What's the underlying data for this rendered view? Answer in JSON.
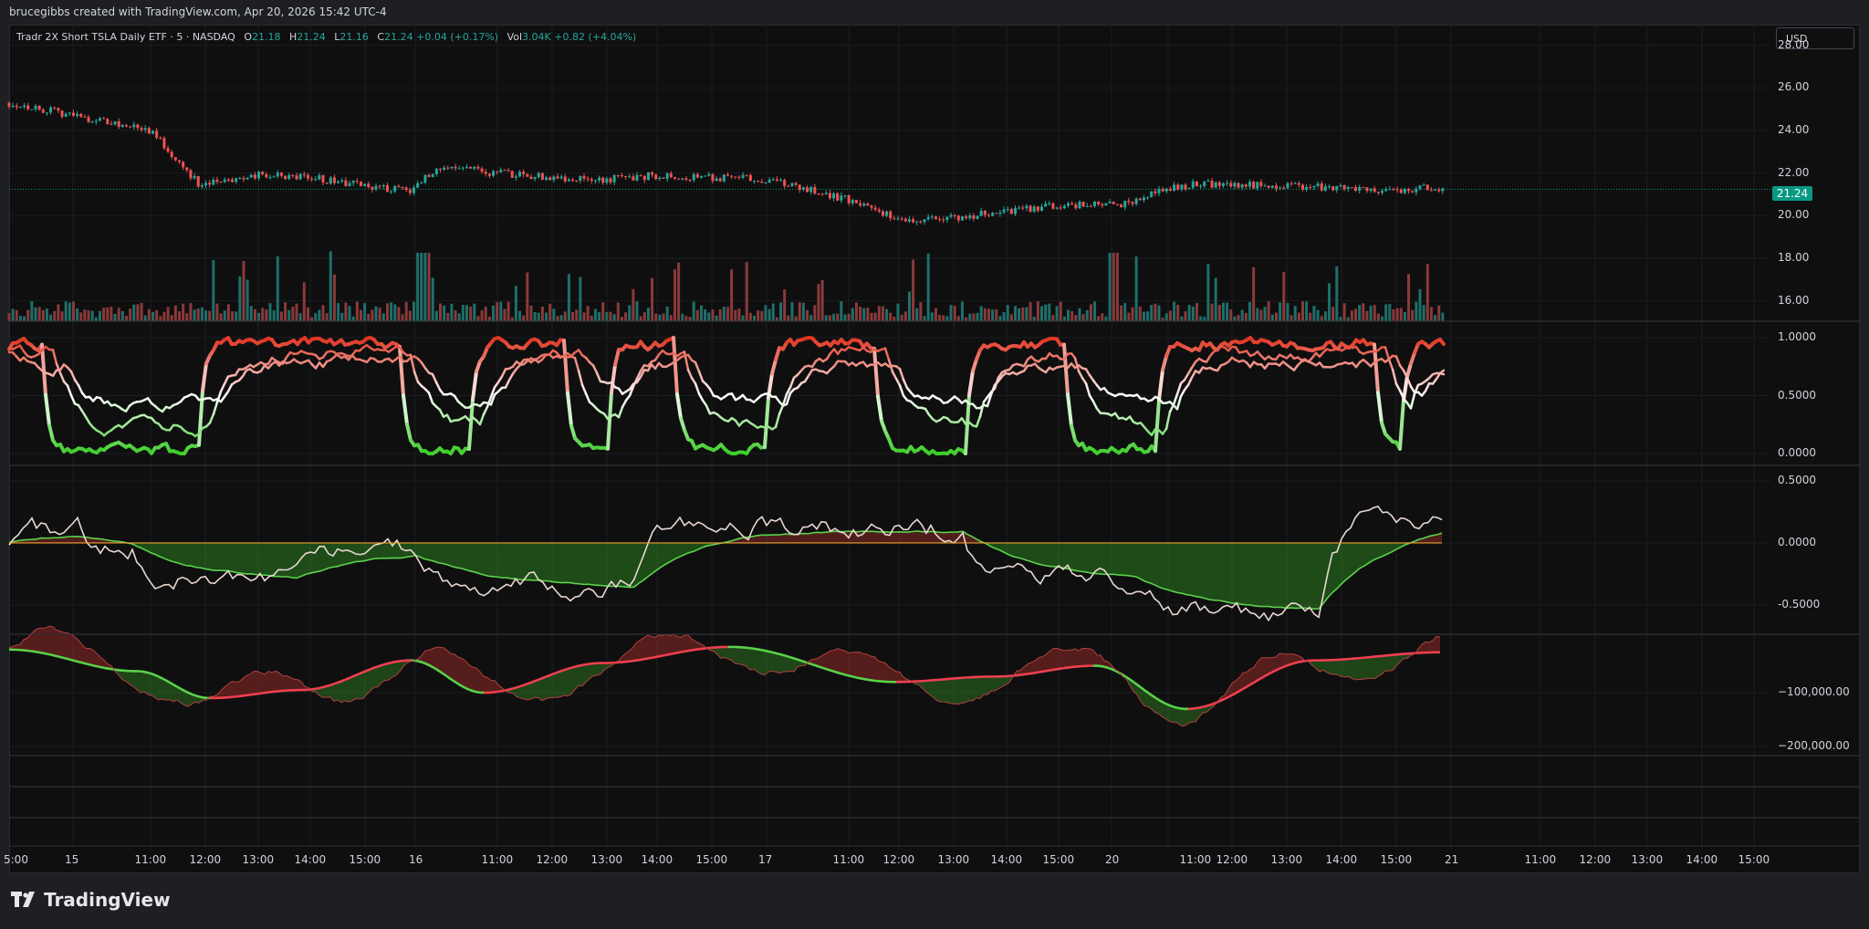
{
  "header": {
    "attribution": "brucegibbs created with TradingView.com, Apr 20, 2026 15:42 UTC-4"
  },
  "legend": {
    "symbol": "Tradr 2X Short TSLA Daily ETF · 5 · NASDAQ",
    "open_label": "O",
    "open": "21.18",
    "high_label": "H",
    "high": "21.24",
    "low_label": "L",
    "low": "21.16",
    "close_label": "C",
    "close": "21.24",
    "change": "+0.04 (+0.17%)",
    "vol_label": "Vol",
    "vol": "3.04K",
    "vol_change": "+0.82 (+4.04%)"
  },
  "currency_button": "USD",
  "price_axis": [
    "28.00",
    "26.00",
    "24.00",
    "22.00",
    "20.00",
    "18.00",
    "16.00"
  ],
  "last_price_tag": "21.24",
  "osc1_axis": [
    "1.0000",
    "0.5000",
    "0.0000"
  ],
  "osc2_axis": [
    "0.5000",
    "0.0000",
    "-0.5000"
  ],
  "osc3_axis": [
    "−100,000.00",
    "−200,000.00"
  ],
  "time_axis": [
    "5:00",
    "15",
    "11:00",
    "12:00",
    "13:00",
    "14:00",
    "15:00",
    "16",
    "11:00",
    "12:00",
    "13:00",
    "14:00",
    "15:00",
    "17",
    "11:00",
    "12:00",
    "13:00",
    "14:00",
    "15:00",
    "20",
    "11:00",
    "12:00",
    "13:00",
    "14:00",
    "15:00",
    "21",
    "11:00",
    "12:00",
    "13:00",
    "14:00",
    "15:00"
  ],
  "brand": "TradingView",
  "colors": {
    "up": "#26a69a",
    "down": "#ef5350",
    "green": "#3fcf2a",
    "red": "#e0301e",
    "bg": "#0f0f10"
  },
  "chart_data": {
    "type": "line",
    "price": {
      "x": [
        "15 09:30",
        "15 11:00",
        "15 12:00",
        "15 13:00",
        "15 14:00",
        "15 15:00",
        "16 09:30",
        "16 10:00",
        "16 11:00",
        "16 12:00",
        "16 13:00",
        "16 14:00",
        "16 15:00",
        "17 09:30",
        "17 11:00",
        "17 11:30",
        "17 12:00",
        "17 13:00",
        "17 14:00",
        "17 15:00",
        "20 09:30",
        "20 10:30",
        "20 11:00",
        "20 12:00",
        "20 13:00",
        "20 14:00",
        "20 15:00",
        "20 15:40"
      ],
      "close": [
        25.3,
        24.0,
        21.4,
        21.9,
        21.8,
        21.4,
        21.2,
        22.3,
        22.0,
        21.8,
        21.7,
        21.9,
        21.8,
        21.7,
        20.8,
        19.8,
        19.9,
        20.2,
        20.5,
        20.5,
        20.4,
        21.3,
        21.5,
        21.4,
        21.3,
        21.2,
        21.3,
        21.24
      ],
      "ylim": [
        15.0,
        28.5
      ]
    },
    "osc1_ylim": [
      0.0,
      1.0
    ],
    "osc2_ylim": [
      -0.7,
      0.5
    ],
    "osc3_ylim": [
      -220000,
      0
    ]
  }
}
